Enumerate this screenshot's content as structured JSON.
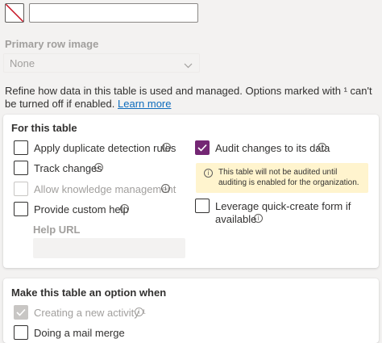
{
  "top": {
    "icon": "no-color-icon",
    "input_value": ""
  },
  "primary_row_image": {
    "label": "Primary row image",
    "value": "None",
    "icon": "chevron-down-icon"
  },
  "description": {
    "text": "Refine how data in this table is used and managed. Options marked with ¹ can't be turned off if enabled.",
    "link": "Learn more"
  },
  "for_this_table": {
    "title": "For this table",
    "options": [
      {
        "label": "Apply duplicate detection rules",
        "checked": false,
        "disabled": false
      },
      {
        "label": "Track changes",
        "checked": false,
        "disabled": false
      },
      {
        "label": "Allow knowledge management",
        "checked": false,
        "disabled": true
      },
      {
        "label": "Provide custom help",
        "checked": false,
        "disabled": false
      }
    ],
    "help_url": {
      "label": "Help URL",
      "value": ""
    },
    "audit": {
      "label": "Audit changes to its data",
      "checked": true,
      "warning": "This table will not be audited until auditing is enabled for the organization."
    },
    "quick_create": {
      "label_line1": "Leverage quick-create form if",
      "label_line2": "available",
      "checked": false
    }
  },
  "make_option": {
    "title": "Make this table an option when",
    "options": [
      {
        "label": "Creating a new activity ¹",
        "checked": true,
        "disabled": true
      },
      {
        "label": "Doing a mail merge",
        "checked": false,
        "disabled": false
      }
    ]
  },
  "colors": {
    "accent": "#742774",
    "link": "#0f6cbd",
    "warning_bg": "#fff4ce",
    "page_bg": "#f3f2f1"
  }
}
